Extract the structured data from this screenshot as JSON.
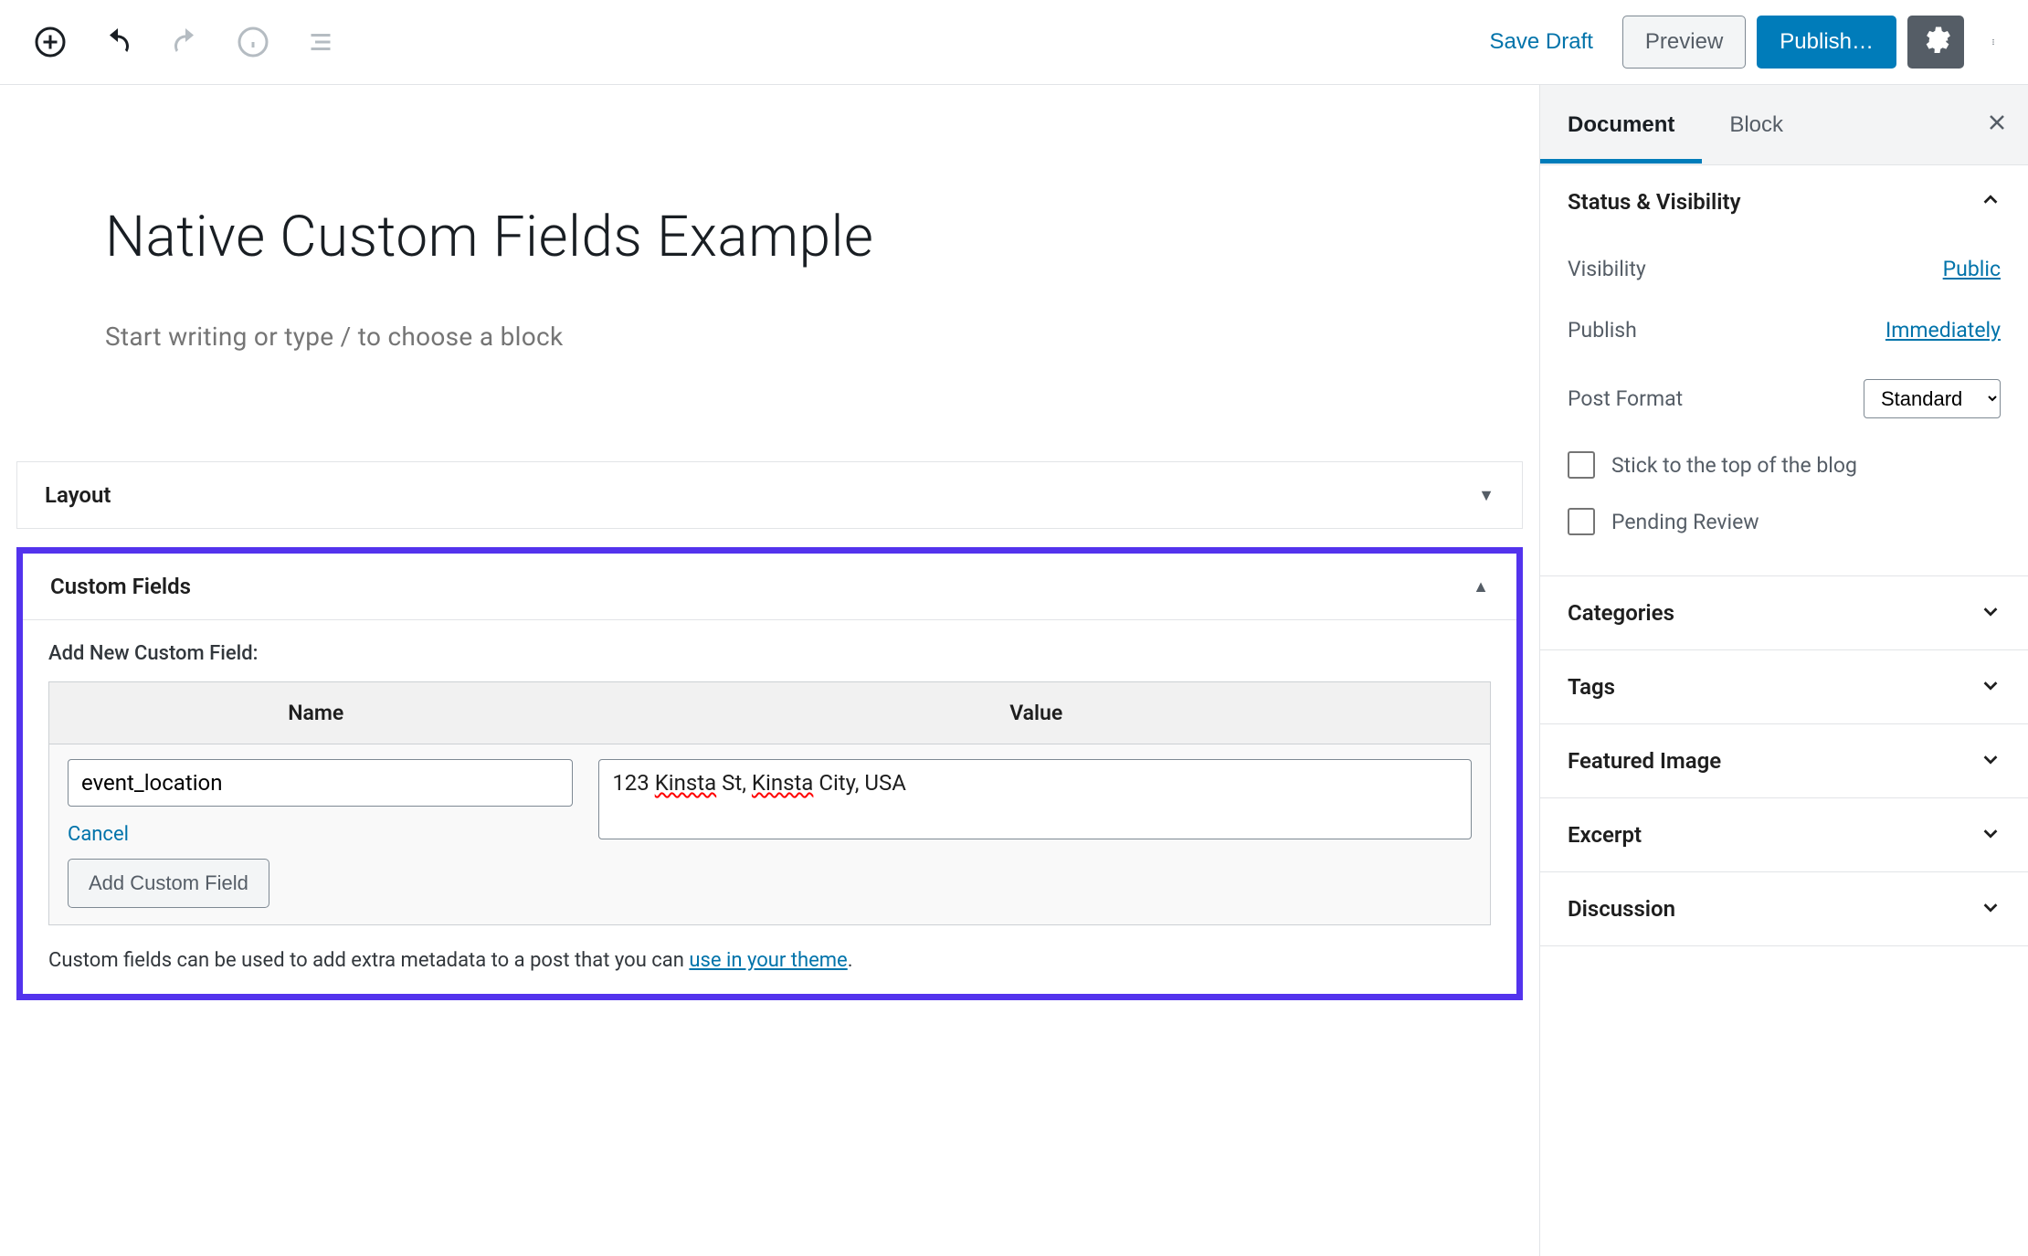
{
  "toolbar": {
    "save_draft": "Save Draft",
    "preview": "Preview",
    "publish": "Publish…"
  },
  "post": {
    "title": "Native Custom Fields Example",
    "placeholder": "Start writing or type / to choose a block"
  },
  "metabox": {
    "layout": {
      "title": "Layout"
    },
    "custom_fields": {
      "title": "Custom Fields",
      "add_label": "Add New Custom Field:",
      "name_header": "Name",
      "value_header": "Value",
      "name_value": "event_location",
      "value_prefix": "123 ",
      "value_sp1": "Kinsta",
      "value_mid": " St, ",
      "value_sp2": "Kinsta",
      "value_suffix": " City, USA",
      "cancel": "Cancel",
      "add_button": "Add Custom Field",
      "hint_prefix": "Custom fields can be used to add extra metadata to a post that you can ",
      "hint_link": "use in your theme",
      "hint_suffix": "."
    }
  },
  "sidebar": {
    "tabs": {
      "document": "Document",
      "block": "Block"
    },
    "status": {
      "title": "Status & Visibility",
      "visibility_label": "Visibility",
      "visibility_value": "Public",
      "publish_label": "Publish",
      "publish_value": "Immediately",
      "format_label": "Post Format",
      "format_value": "Standard",
      "stick": "Stick to the top of the blog",
      "pending": "Pending Review"
    },
    "panels": {
      "categories": "Categories",
      "tags": "Tags",
      "featured_image": "Featured Image",
      "excerpt": "Excerpt",
      "discussion": "Discussion"
    }
  }
}
